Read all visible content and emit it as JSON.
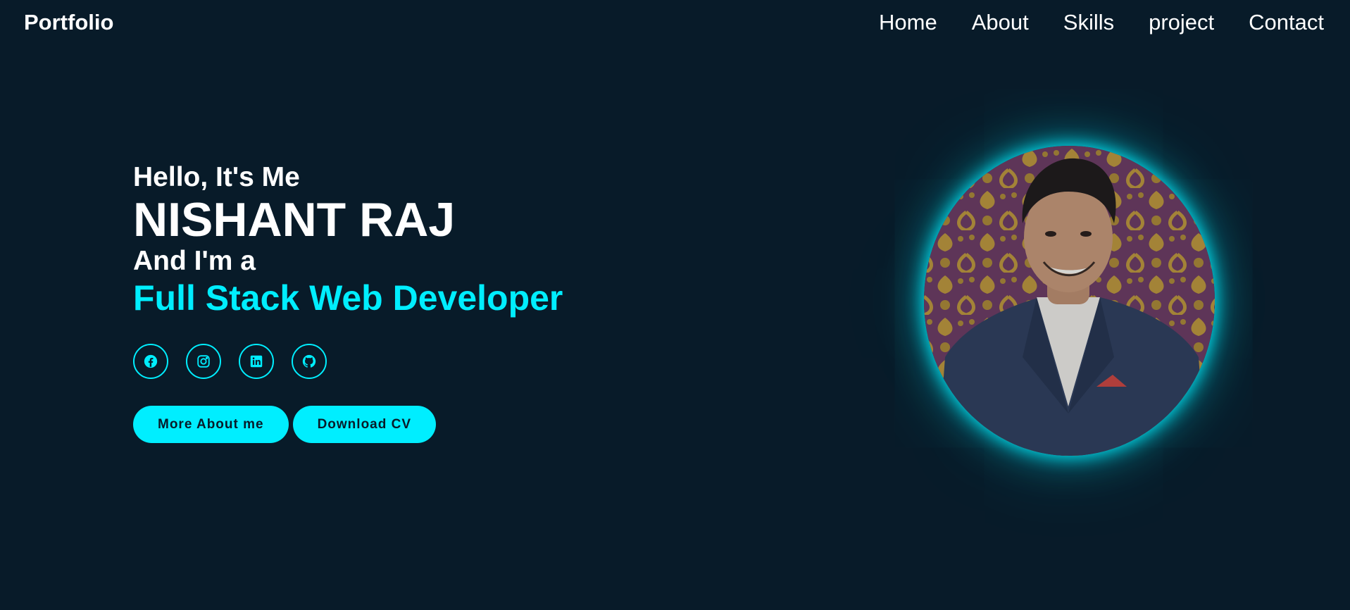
{
  "header": {
    "logo": "Portfolio",
    "nav": [
      "Home",
      "About",
      "Skills",
      "project",
      "Contact"
    ]
  },
  "hero": {
    "greeting": "Hello, It's Me",
    "name": "NISHANT RAJ",
    "role_intro": "And I'm a",
    "role": "Full Stack Web Developer"
  },
  "socials": [
    {
      "icon": "facebook-icon"
    },
    {
      "icon": "instagram-icon"
    },
    {
      "icon": "linkedin-icon"
    },
    {
      "icon": "github-icon"
    }
  ],
  "buttons": {
    "more_about": "More About me",
    "download_cv": "Download CV"
  },
  "colors": {
    "background": "#081b29",
    "accent": "#00eeff",
    "text": "#ffffff"
  }
}
